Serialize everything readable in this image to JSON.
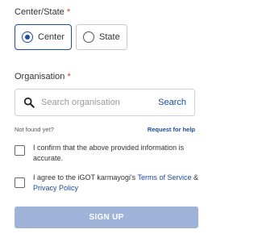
{
  "center_state": {
    "label": "Center/State",
    "required_mark": "*",
    "options": [
      {
        "label": "Center",
        "selected": true
      },
      {
        "label": "State",
        "selected": false
      }
    ]
  },
  "organisation": {
    "label": "Organisation",
    "required_mark": "*",
    "placeholder": "Search organisation",
    "search_button": "Search"
  },
  "not_found_text": "Not found yet?",
  "request_help": "Request for help",
  "confirm_text": "I confirm that the above provided information is accurate.",
  "agree": {
    "prefix": "I agree to the iGOT karmayogi's ",
    "terms_link": "Terms of Service",
    "and": " & ",
    "privacy_link": "Privacy Policy"
  },
  "signup_label": "SIGN UP",
  "colors": {
    "accent": "#1b4ca1",
    "required": "#d13924",
    "signup_disabled": "#9fb2d8"
  },
  "icons": {
    "search": "search-icon"
  }
}
